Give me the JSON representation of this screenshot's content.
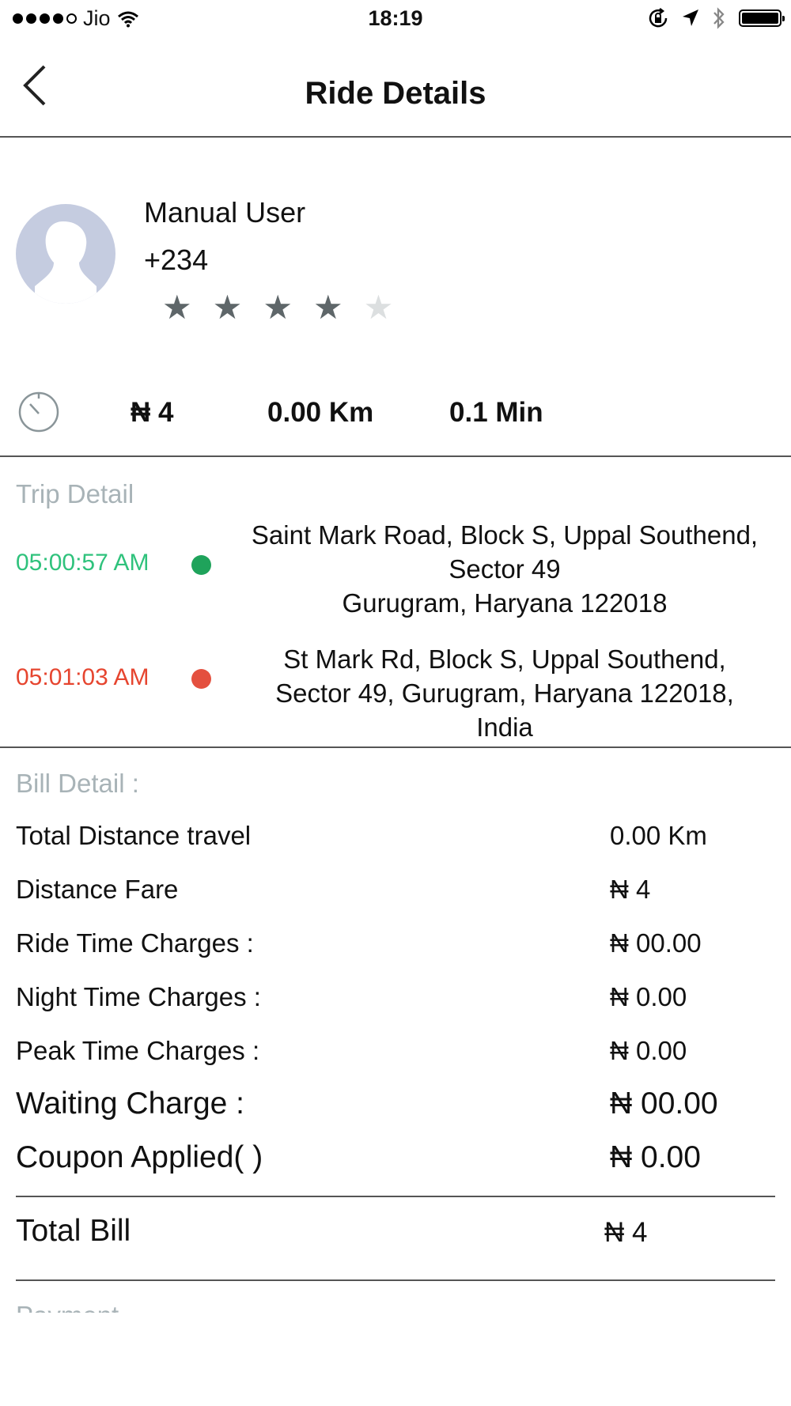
{
  "status_bar": {
    "carrier": "Jio",
    "time": "18:19"
  },
  "nav": {
    "title": "Ride Details"
  },
  "profile": {
    "name": "Manual User",
    "phone": "+234",
    "rating": 4,
    "rating_max": 5
  },
  "summary": {
    "fare": "₦ 4",
    "distance": "0.00 Km",
    "duration": "0.1 Min"
  },
  "trip": {
    "label": "Trip Detail",
    "pickup": {
      "time": "05:00:57 AM",
      "address": "Saint Mark Road, Block S, Uppal Southend,\nSector 49\nGurugram, Haryana 122018",
      "color": "#1fa35b"
    },
    "drop": {
      "time": "05:01:03 AM",
      "address": "St Mark Rd, Block S, Uppal Southend,\nSector 49, Gurugram, Haryana 122018,\nIndia",
      "color": "#e4503f"
    }
  },
  "bill": {
    "label": "Bill Detail :",
    "rows": [
      {
        "name": "Total Distance travel",
        "value": "0.00 Km"
      },
      {
        "name": "Distance Fare",
        "value": "₦ 4"
      },
      {
        "name": "Ride Time Charges :",
        "value": "₦ 00.00"
      },
      {
        "name": "Night Time Charges :",
        "value": "₦ 0.00"
      },
      {
        "name": "Peak Time Charges :",
        "value": "₦ 0.00"
      },
      {
        "name": "Waiting Charge :",
        "value": "₦ 00.00"
      },
      {
        "name": "Coupon Applied(  )",
        "value": "₦ 0.00"
      }
    ],
    "total_label": "Total Bill",
    "total_value": "₦ 4",
    "next_section": "Payment"
  }
}
